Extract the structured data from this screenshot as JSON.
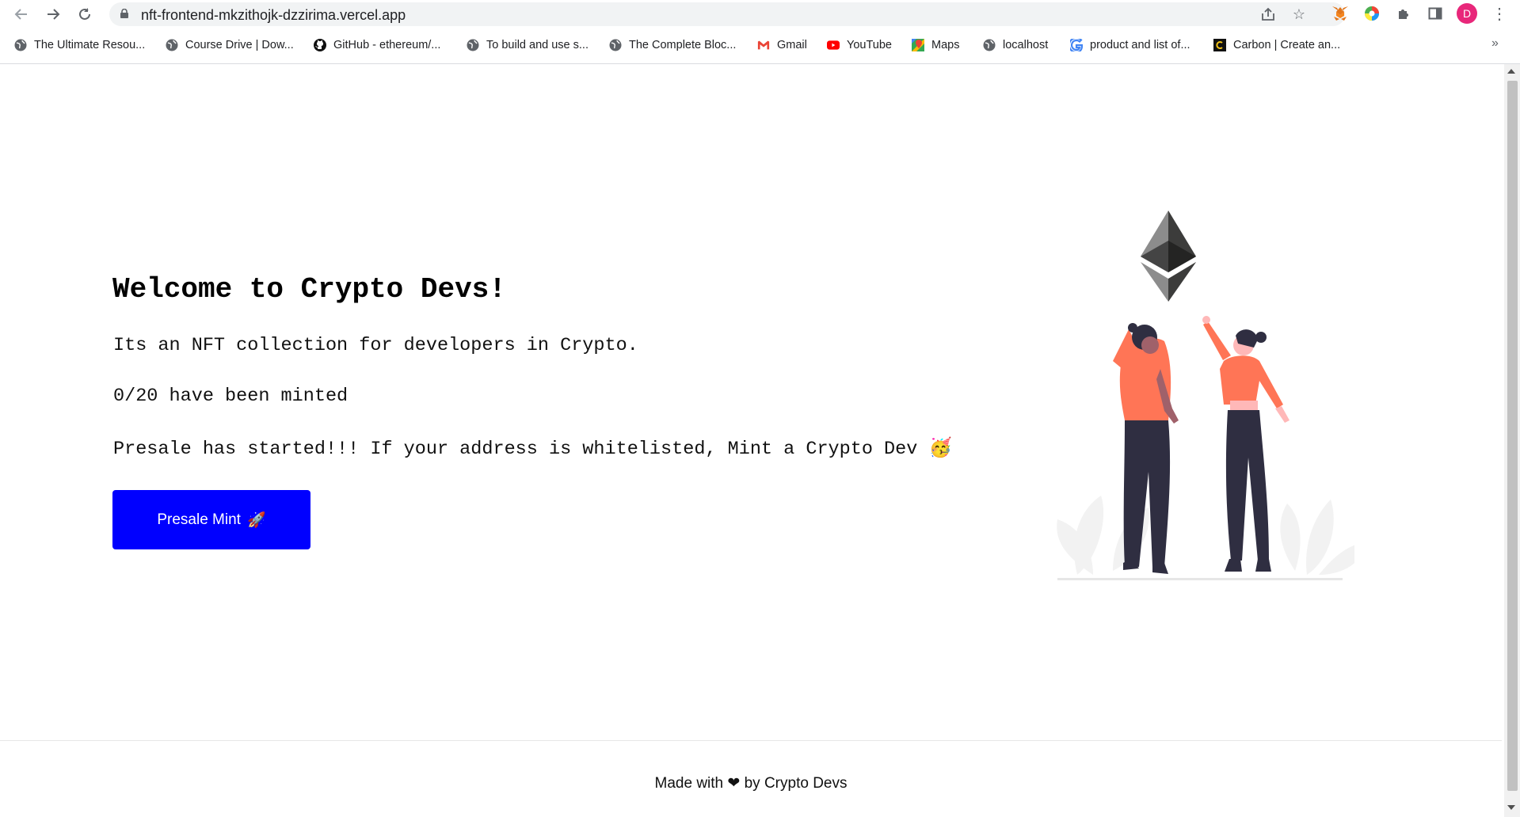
{
  "browser": {
    "url": "nft-frontend-mkzithojk-dzzirima.vercel.app",
    "profile_initial": "D",
    "bookmarks": [
      {
        "label": "The Ultimate Resou...",
        "icon": "globe-icon"
      },
      {
        "label": "Course Drive | Dow...",
        "icon": "globe-icon"
      },
      {
        "label": "GitHub - ethereum/...",
        "icon": "github-icon"
      },
      {
        "label": "To build and use s...",
        "icon": "globe-icon"
      },
      {
        "label": "The Complete Bloc...",
        "icon": "globe-icon"
      },
      {
        "label": "Gmail",
        "icon": "gmail-icon"
      },
      {
        "label": "YouTube",
        "icon": "youtube-icon"
      },
      {
        "label": "Maps",
        "icon": "maps-icon"
      },
      {
        "label": "localhost",
        "icon": "globe-icon"
      },
      {
        "label": "product and list of...",
        "icon": "google-icon"
      },
      {
        "label": "Carbon | Create an...",
        "icon": "carbon-icon"
      }
    ],
    "more_label": "»"
  },
  "page": {
    "title": "Welcome to Crypto Devs!",
    "description": "Its an NFT collection for developers in Crypto.",
    "minted": "0/20 have been minted",
    "presale_message": "Presale has started!!! If your address is whitelisted, Mint a Crypto Dev 🥳",
    "mint_button_label": "Presale Mint",
    "mint_button_emoji": "🚀",
    "footer": {
      "before": "Made with",
      "heart": "❤",
      "after": "by Crypto Devs"
    }
  },
  "colors": {
    "button": "#0000ff",
    "illustration_accent": "#ff7556",
    "illustration_dark": "#2f2e41"
  }
}
